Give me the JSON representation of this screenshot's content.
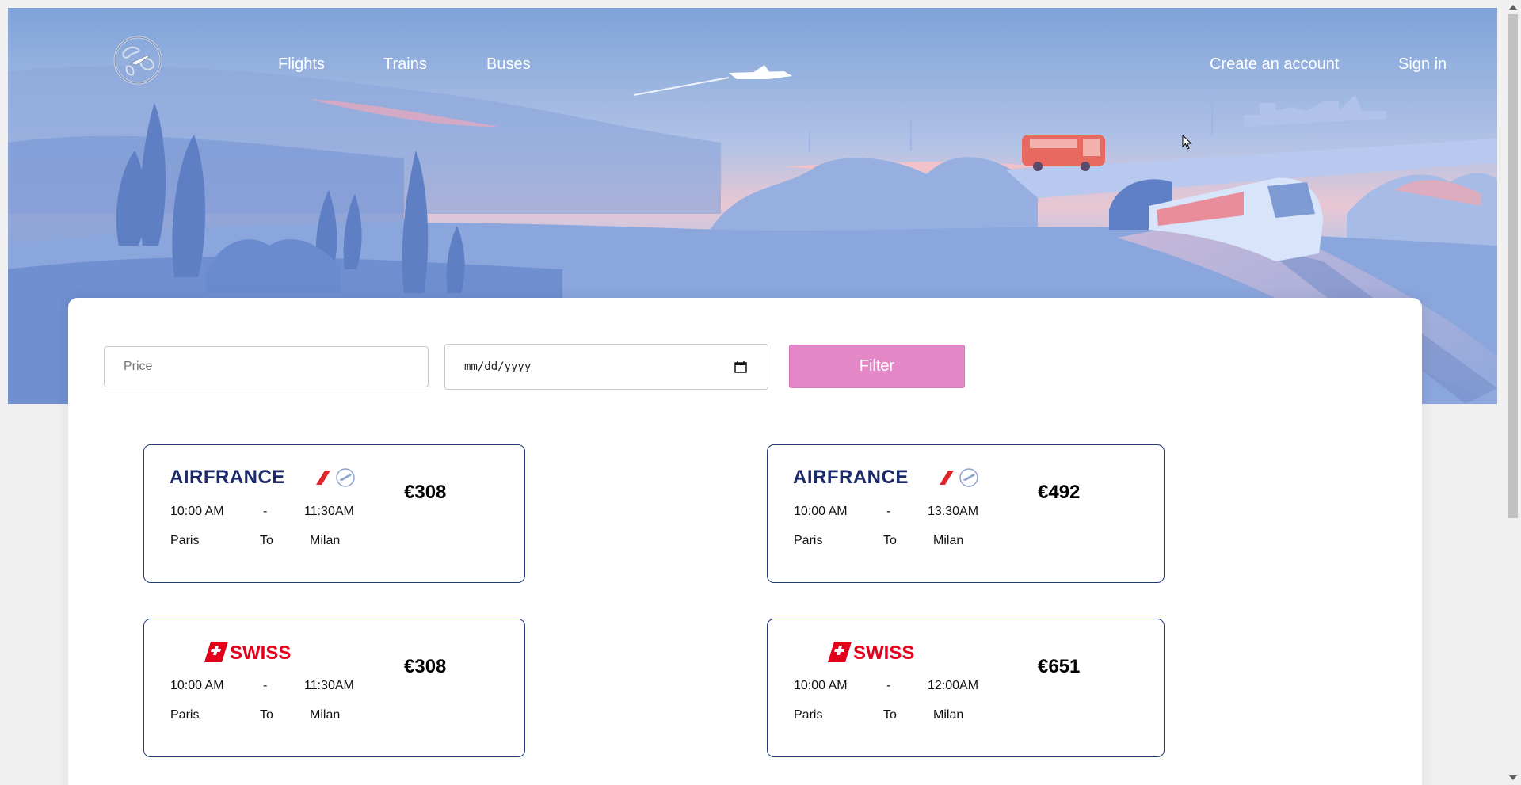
{
  "nav": {
    "logo_icon": "globe-plane-icon",
    "links": [
      "Flights",
      "Trains",
      "Buses"
    ],
    "create_account": "Create an account",
    "sign_in": "Sign in"
  },
  "filter": {
    "price_placeholder": "Price",
    "date_placeholder": "mm/dd/yyyy",
    "button_label": "Filter"
  },
  "results": [
    {
      "airline": "AIRFRANCE",
      "depart": "10:00 AM",
      "sep": "-",
      "arrive": "11:30AM",
      "from": "Paris",
      "to_label": "To",
      "to": "Milan",
      "price": "€308"
    },
    {
      "airline": "AIRFRANCE",
      "depart": "10:00 AM",
      "sep": "-",
      "arrive": "13:30AM",
      "from": "Paris",
      "to_label": "To",
      "to": "Milan",
      "price": "€492"
    },
    {
      "airline": "SWISS",
      "depart": "10:00 AM",
      "sep": "-",
      "arrive": "11:30AM",
      "from": "Paris",
      "to_label": "To",
      "to": "Milan",
      "price": "€308"
    },
    {
      "airline": "SWISS",
      "depart": "10:00 AM",
      "sep": "-",
      "arrive": "12:00AM",
      "from": "Paris",
      "to_label": "To",
      "to": "Milan",
      "price": "€651"
    }
  ],
  "colors": {
    "accent_button": "#e387c7",
    "card_border": "#1e3a7a",
    "airfrance_blue": "#1c2a6b",
    "airfrance_red": "#e0242b",
    "swiss_red": "#e3001b"
  }
}
